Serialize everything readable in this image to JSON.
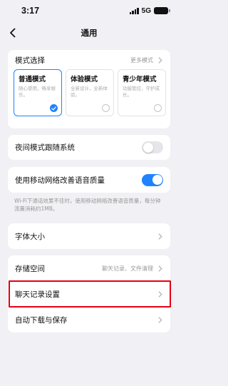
{
  "status_bar": {
    "time": "3:17",
    "network": "5G"
  },
  "nav": {
    "title": "通用"
  },
  "mode_select": {
    "label": "模式选择",
    "more_label": "更多模式",
    "options": [
      {
        "title": "普通模式",
        "desc": "随心使用，畅享娱乐。",
        "selected": true
      },
      {
        "title": "体验模式",
        "desc": "全新设计，全新体验。",
        "selected": false
      },
      {
        "title": "青少年模式",
        "desc": "功能管控，守护成长。",
        "selected": false
      }
    ]
  },
  "night_mode": {
    "label": "夜间模式跟随系统",
    "enabled": false
  },
  "mobile_voice": {
    "label": "使用移动网络改善语音质量",
    "enabled": true,
    "note": "Wi-Fi下通话效果不佳时，使用移动网络改善语音质量，每分钟流量消耗约1MB。"
  },
  "font_size": {
    "label": "字体大小"
  },
  "storage": {
    "label": "存储空间",
    "value": "聊天记录、文件清理"
  },
  "chat_history": {
    "label": "聊天记录设置"
  },
  "auto_download": {
    "label": "自动下载与保存"
  },
  "colors": {
    "accent": "#1f83ff",
    "highlight": "#e60012",
    "background": "#f0f0f5"
  }
}
